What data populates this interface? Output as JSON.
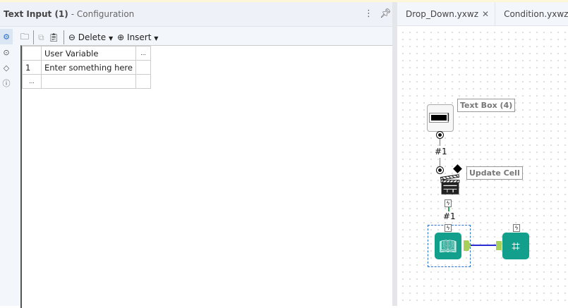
{
  "panel": {
    "title": "Text Input (1)",
    "subtitle": "- Configuration"
  },
  "toolbar": {
    "delete_label": "Delete",
    "insert_label": "Insert"
  },
  "table": {
    "header": "User Variable",
    "more": "...",
    "rows": [
      {
        "num": "1",
        "value": "Enter something here"
      }
    ],
    "new_row": "..."
  },
  "tabs": [
    {
      "label": "Drop_Down.yxwz"
    },
    {
      "label": "Condition.yxwz"
    }
  ],
  "canvas": {
    "textbox_label": "Text Box (4)",
    "update_label": "Update Cell",
    "conn1": "#1",
    "conn2": "#1"
  }
}
